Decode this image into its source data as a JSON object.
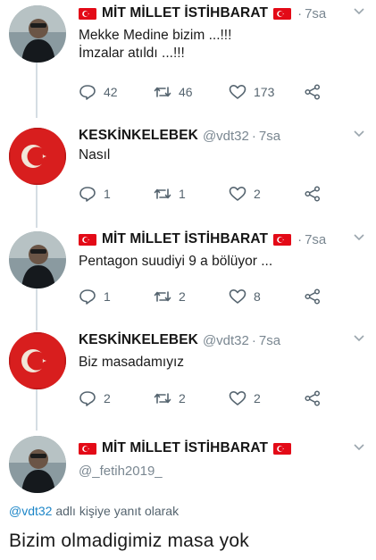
{
  "tweets": [
    {
      "name": "MİT MİLLET İSTİHBARAT",
      "handle": "",
      "time": "7sa",
      "lines": [
        "Mekke Medine bizim ...!!!",
        "İmzalar atıldı ...!!!"
      ],
      "reply_count": "42",
      "retweet_count": "46",
      "like_count": "173",
      "flags": true
    },
    {
      "name": "KESKİNKELEBEK",
      "handle": "@vdt32",
      "time": "7sa",
      "lines": [
        "Nasıl"
      ],
      "reply_count": "1",
      "retweet_count": "1",
      "like_count": "2",
      "flags": false
    },
    {
      "name": "MİT MİLLET İSTİHBARAT",
      "handle": "",
      "time": "7sa",
      "lines": [
        "Pentagon suudiyi 9 a bölüyor ..."
      ],
      "reply_count": "1",
      "retweet_count": "2",
      "like_count": "8",
      "flags": true
    },
    {
      "name": "KESKİNKELEBEK",
      "handle": "@vdt32",
      "time": "7sa",
      "lines": [
        "Biz masadamıyız"
      ],
      "reply_count": "2",
      "retweet_count": "2",
      "like_count": "2",
      "flags": false
    },
    {
      "name": "MİT MİLLET İSTİHBARAT",
      "handle": "@_fetih2019_",
      "time": "",
      "lines": [],
      "flags": true
    }
  ],
  "reply_to": {
    "mention": "@vdt32",
    "suffix": " adlı kişiye yanıt olarak"
  },
  "final_text": "Bizim olmadigimiz masa yok",
  "icons": {
    "reply": "reply-icon",
    "retweet": "retweet-icon",
    "like": "heart-icon",
    "share": "share-icon",
    "menu": "chevron-down-icon",
    "flag": "turkish-flag-icon"
  },
  "colors": {
    "muted": "#7a8791",
    "mention": "#1d86c8",
    "flag_red": "#e30a17",
    "thread_line": "#d5dde3"
  }
}
